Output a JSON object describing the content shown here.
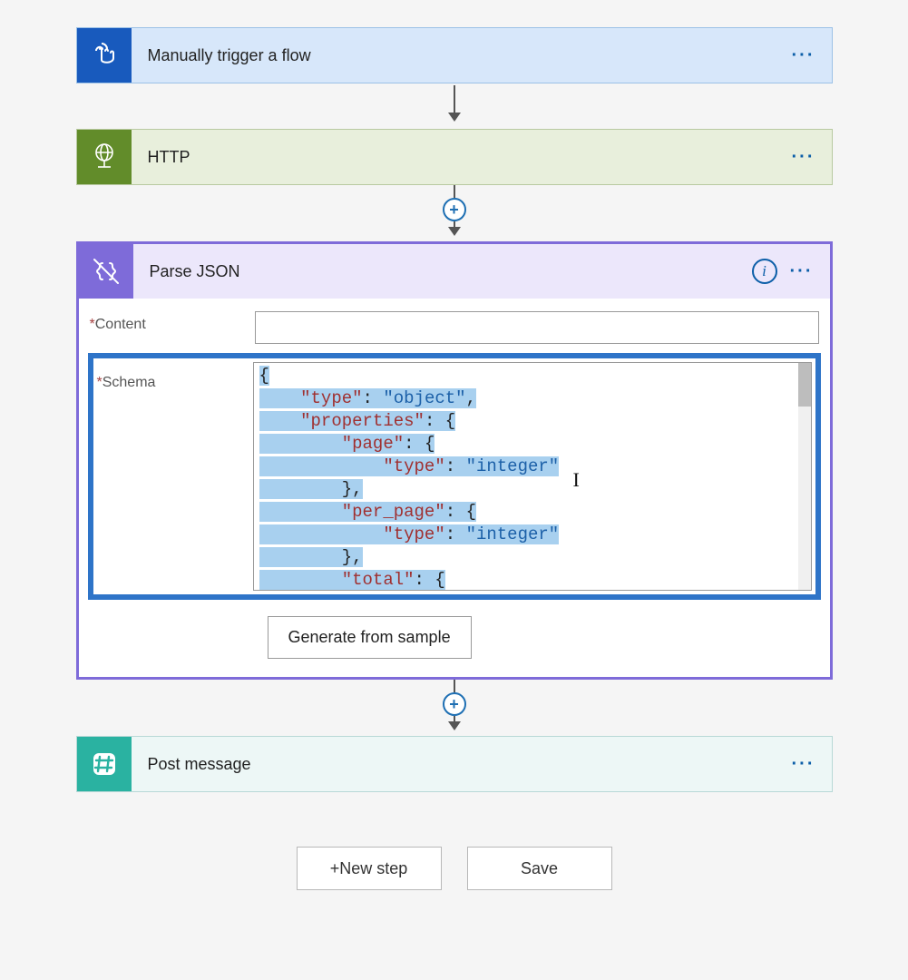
{
  "steps": {
    "trigger": {
      "title": "Manually trigger a flow"
    },
    "http": {
      "title": "HTTP"
    },
    "parse": {
      "title": "Parse JSON"
    },
    "post": {
      "title": "Post message"
    }
  },
  "parse_json": {
    "content_label": "Content",
    "content_value": "",
    "schema_label": "Schema",
    "generate_button": "Generate from sample",
    "schema_code": {
      "l1_open": "{",
      "l2_key": "\"type\"",
      "l2_str": "\"object\"",
      "l3_key": "\"properties\"",
      "l4_key": "\"page\"",
      "l5_key": "\"type\"",
      "l5_str": "\"integer\"",
      "l7_key": "\"per_page\"",
      "l8_key": "\"type\"",
      "l8_str": "\"integer\"",
      "l10_key": "\"total\"",
      "colon": ":",
      "comma": ",",
      "ob": "{",
      "cb": "}",
      "cbc": "},",
      "ind1": "    ",
      "ind2": "        ",
      "ind3": "            "
    }
  },
  "footer": {
    "new_step": "New step",
    "save": "Save"
  },
  "plus": "+",
  "info": "i",
  "ellipsis": "···"
}
